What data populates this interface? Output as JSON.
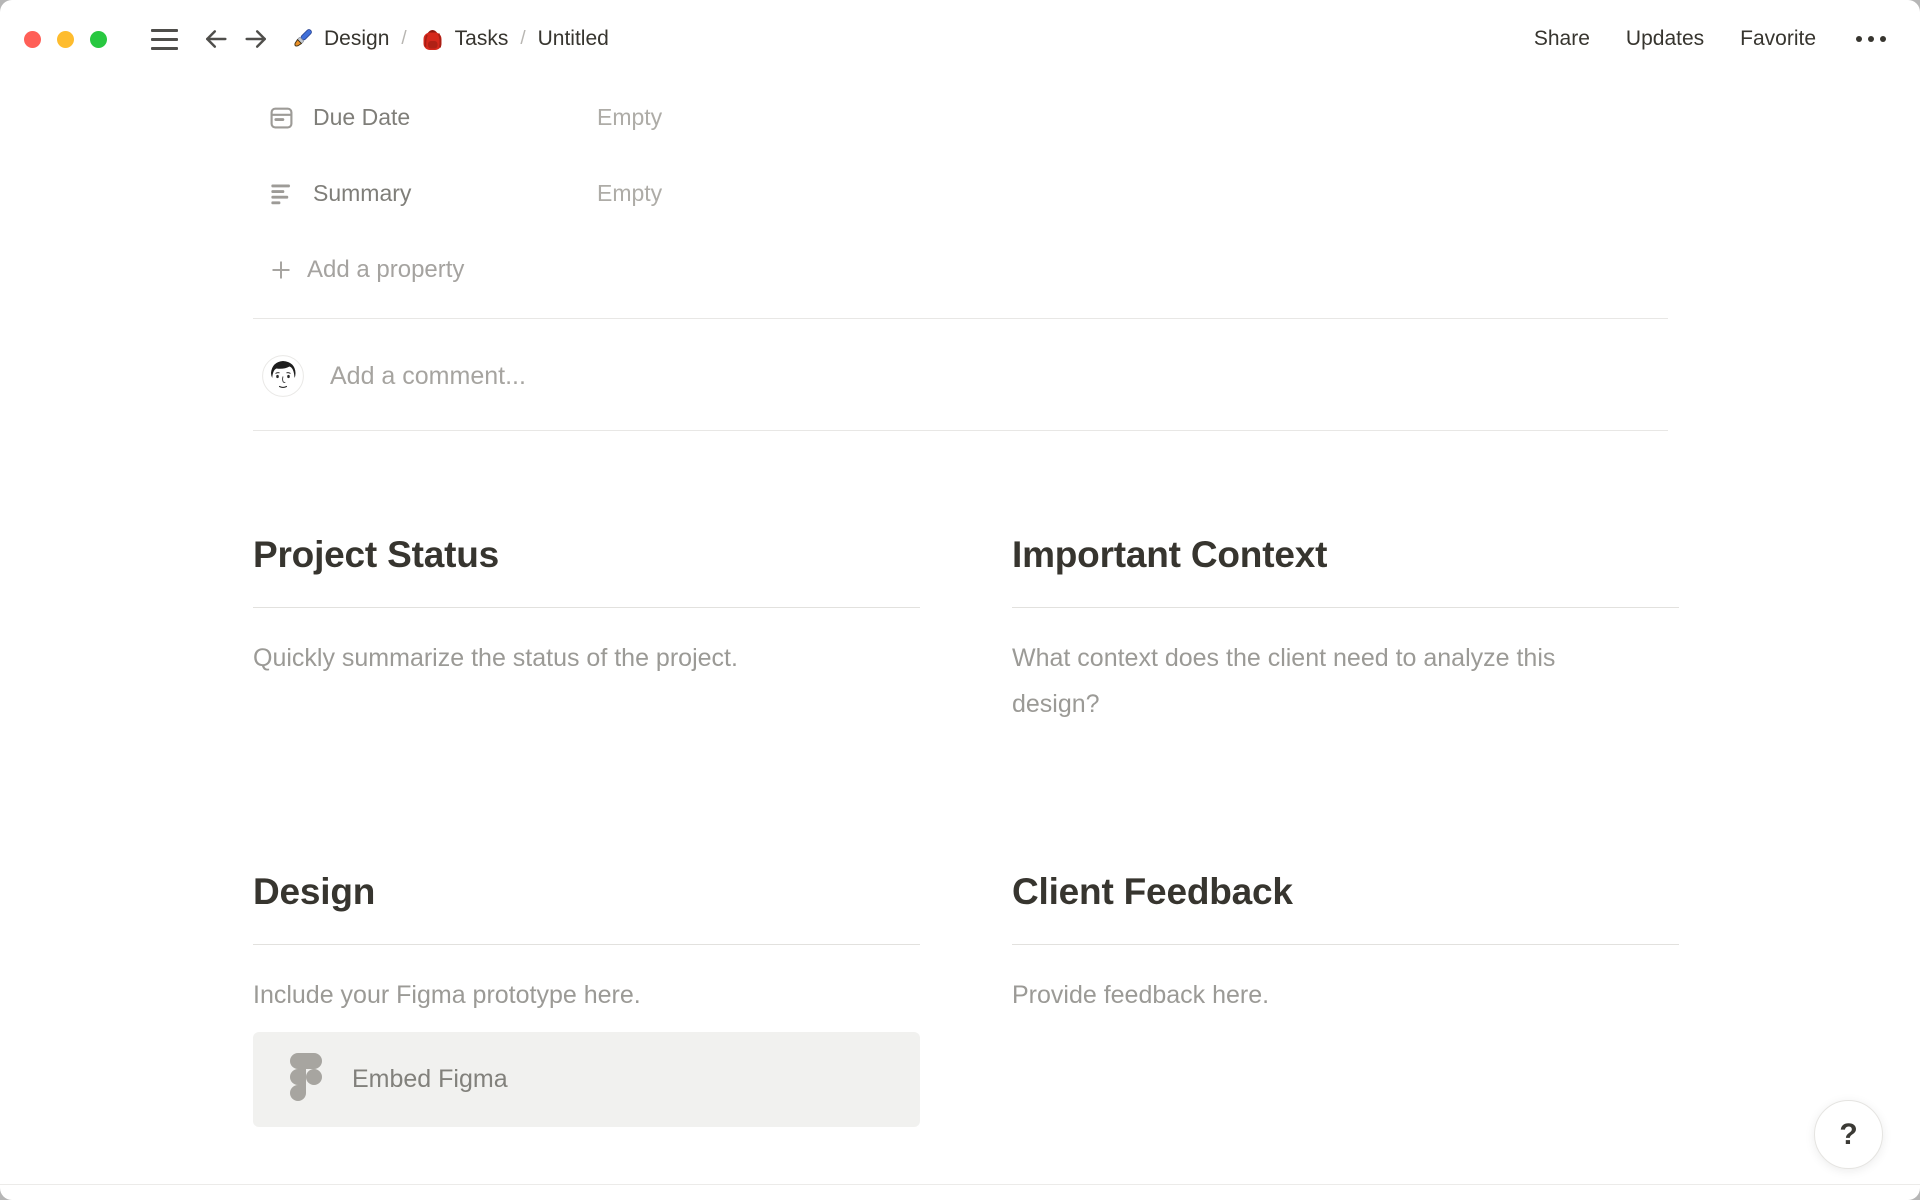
{
  "topbar": {
    "breadcrumb": [
      {
        "icon": "paintbrush-icon",
        "label": "Design"
      },
      {
        "icon": "backpack-icon",
        "label": "Tasks"
      },
      {
        "icon": null,
        "label": "Untitled"
      }
    ],
    "separator": "/",
    "actions": [
      {
        "label": "Share"
      },
      {
        "label": "Updates"
      },
      {
        "label": "Favorite"
      }
    ],
    "more_icon": "ellipsis-icon"
  },
  "properties": {
    "rows": [
      {
        "icon": "calendar-icon",
        "label": "Due Date",
        "value": "Empty"
      },
      {
        "icon": "align-left-icon",
        "label": "Summary",
        "value": "Empty"
      }
    ],
    "add_label": "Add a property"
  },
  "comment": {
    "avatar_icon": "user-avatar",
    "placeholder": "Add a comment..."
  },
  "sections": [
    {
      "title": "Project Status",
      "body": "Quickly summarize the status of the project."
    },
    {
      "title": "Important Context",
      "body": "What context does the client need to analyze this design?"
    },
    {
      "title": "Design",
      "body": "Include your Figma prototype here.",
      "embed": {
        "icon": "figma-icon",
        "label": "Embed Figma"
      }
    },
    {
      "title": "Client Feedback",
      "body": "Provide feedback here."
    }
  ],
  "help": {
    "label": "?"
  },
  "colors": {
    "traffic_red": "#ff5f57",
    "traffic_yellow": "#febc2e",
    "traffic_green": "#28c840",
    "heading_text": "#37352f",
    "muted_text": "#9b9a97",
    "embed_bg": "#f1f1ef",
    "figma_icon_gray": "#a7a5a0"
  }
}
